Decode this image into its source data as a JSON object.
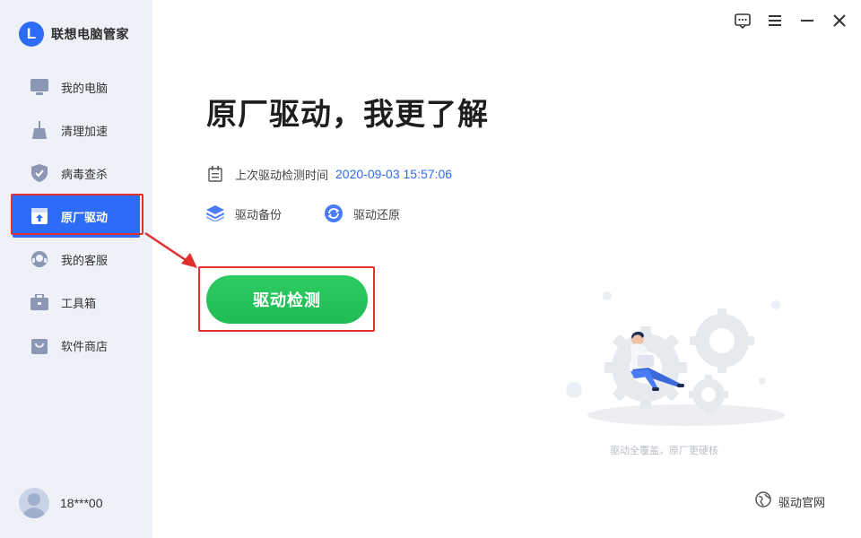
{
  "app": {
    "name": "联想电脑管家",
    "logo_letter": "L"
  },
  "sidebar": {
    "items": [
      {
        "label": "我的电脑",
        "icon": "laptop-icon"
      },
      {
        "label": "清理加速",
        "icon": "broom-icon"
      },
      {
        "label": "病毒查杀",
        "icon": "shield-icon"
      },
      {
        "label": "原厂驱动",
        "icon": "driver-box-icon",
        "active": true
      },
      {
        "label": "我的客服",
        "icon": "headset-icon"
      },
      {
        "label": "工具箱",
        "icon": "toolbox-icon"
      },
      {
        "label": "软件商店",
        "icon": "shopping-bag-icon"
      }
    ],
    "user": {
      "name": "18***00"
    }
  },
  "window_controls": [
    "feedback-icon",
    "menu-icon",
    "minimize-icon",
    "close-icon"
  ],
  "main": {
    "title": "原厂驱动，我更了解",
    "last_check_label": "上次驱动检测时间",
    "last_check_time": "2020-09-03 15:57:06",
    "backup_label": "驱动备份",
    "restore_label": "驱动还原",
    "detect_button": "驱动检测",
    "illustration_caption": "驱动全覆盖，原厂更硬核",
    "official_site": "驱动官网"
  },
  "colors": {
    "accent": "#2d6cf6",
    "primary_button": "#22c55e",
    "highlight_box": "#e0302f",
    "sidebar_bg": "#eef1f7"
  }
}
